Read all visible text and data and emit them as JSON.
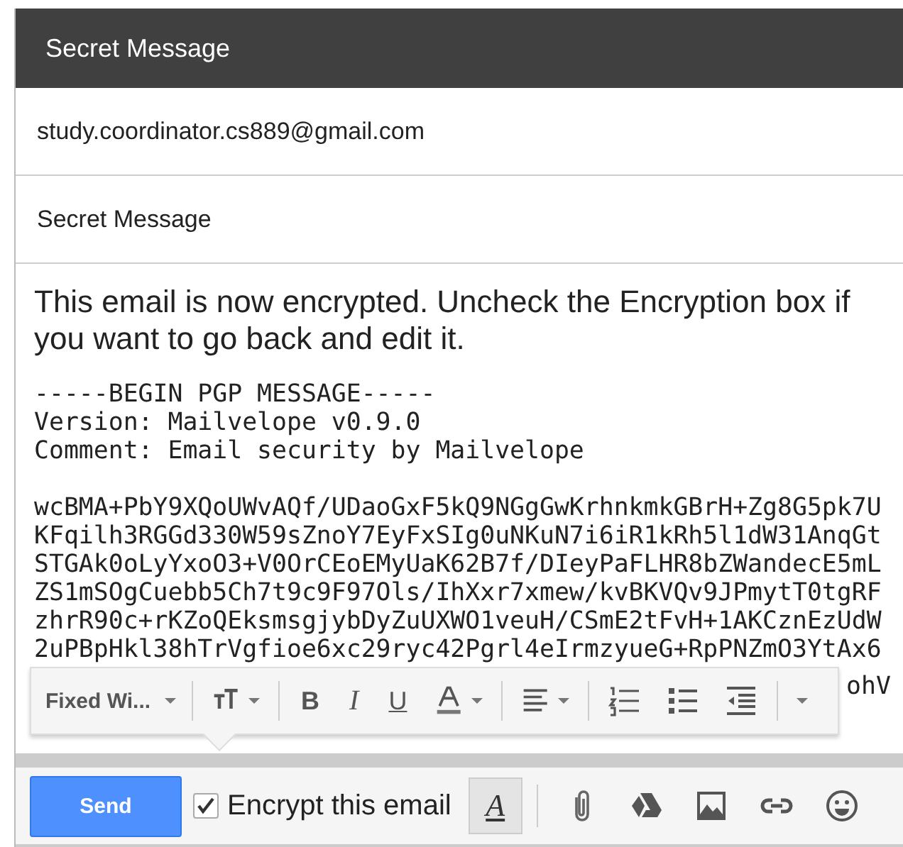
{
  "window": {
    "title": "Secret Message"
  },
  "recipient": "study.coordinator.cs889@gmail.com",
  "subject": "Secret Message",
  "body": {
    "notice": "This email is now encrypted. Uncheck the Encryption box if you want to go back and edit it.",
    "armor": [
      "-----BEGIN PGP MESSAGE-----",
      "Version: Mailvelope v0.9.0",
      "Comment: Email security by Mailvelope"
    ],
    "cipher": [
      "wcBMA+PbY9XQoUWvAQf/UDaoGxF5kQ9NGgGwKrhnkmkGBrH+Zg8G5pk7U",
      "KFqilh3RGGd330W59sZnoY7EyFxSIg0uNKuN7i6iR1kRh5l1dW31AnqGt",
      "STGAk0oLyYxoO3+V0OrCEoEMyUaK62B7f/DIeyPaFLHR8bZWandecE5mL",
      "ZS1mSOgCuebb5Ch7t9c9F97Ols/IhXxr7xmew/kvBKVQv9JPmytT0tgRF",
      "zhrR90c+rKZoQEksmsgjybDyZuUXWO1veuH/CSmE2tFvH+1AKCznEzUdW",
      "2uPBpHkl38hTrVgfioe6xc29ryc42Pgrl4eIrmzyueG+RpPNZmO3YtAx6"
    ],
    "fragment": "ohV"
  },
  "toolbar": {
    "font": "Fixed Wi...",
    "items": [
      {
        "kind": "size"
      },
      {
        "kind": "letter",
        "label": "B"
      },
      {
        "kind": "letter",
        "label": "I"
      },
      {
        "kind": "letter",
        "label": "U"
      },
      {
        "kind": "color"
      },
      {
        "kind": "align"
      },
      {
        "kind": "numbered"
      },
      {
        "kind": "bulleted"
      },
      {
        "kind": "indent"
      },
      {
        "kind": "more"
      }
    ]
  },
  "bottom": {
    "send": "Send",
    "encrypt": {
      "label": "Encrypt this email",
      "checked": true
    },
    "formatting": {
      "label": "A",
      "selected": true
    }
  }
}
